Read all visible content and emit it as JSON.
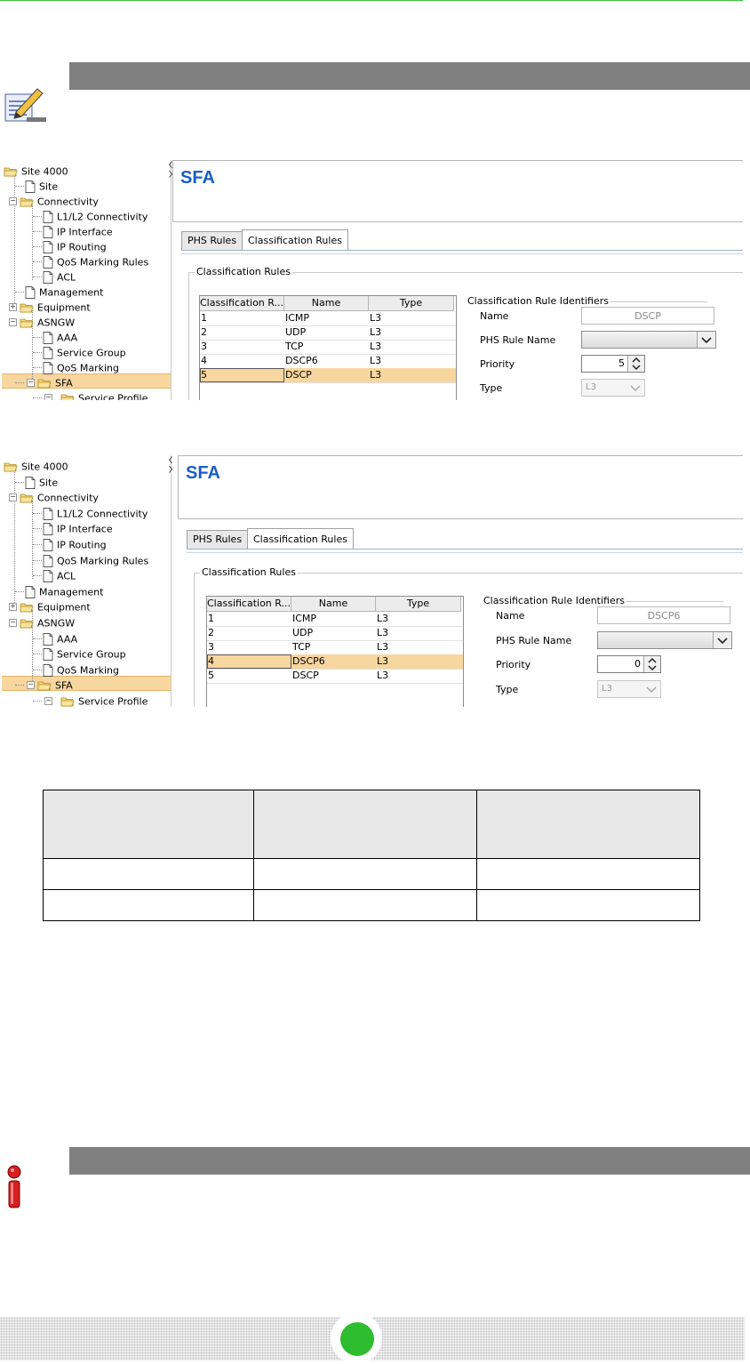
{
  "screenshots": [
    {
      "tree": {
        "root": "Site 4000",
        "items": [
          "Site",
          "Connectivity",
          "L1/L2 Connectivity",
          "IP Interface",
          "IP Routing",
          "QoS Marking Rules",
          "ACL",
          "Management",
          "Equipment",
          "ASNGW",
          "AAA",
          "Service Group",
          "QoS Marking",
          "SFA",
          "Service Profile"
        ]
      },
      "panel_title": "SFA",
      "tabs": [
        "PHS Rules",
        "Classification Rules"
      ],
      "group_title": "Classification Rules",
      "table": {
        "columns": [
          "Classification R...",
          "Name",
          "Type"
        ],
        "rows": [
          [
            "1",
            "ICMP",
            "L3"
          ],
          [
            "2",
            "UDP",
            "L3"
          ],
          [
            "3",
            "TCP",
            "L3"
          ],
          [
            "4",
            "DSCP6",
            "L3"
          ],
          [
            "5",
            "DSCP",
            "L3"
          ]
        ],
        "selected_row": 5
      },
      "identifiers": {
        "title": "Classification Rule Identifiers",
        "name_label": "Name",
        "name_value": "DSCP",
        "phs_label": "PHS Rule Name",
        "priority_label": "Priority",
        "priority_value": "5",
        "type_label": "Type",
        "type_value": "L3"
      }
    },
    {
      "tree": {
        "root": "Site 4000",
        "items": [
          "Site",
          "Connectivity",
          "L1/L2 Connectivity",
          "IP Interface",
          "IP Routing",
          "QoS Marking Rules",
          "ACL",
          "Management",
          "Equipment",
          "ASNGW",
          "AAA",
          "Service Group",
          "QoS Marking",
          "SFA",
          "Service Profile"
        ]
      },
      "panel_title": "SFA",
      "tabs": [
        "PHS Rules",
        "Classification Rules"
      ],
      "group_title": "Classification Rules",
      "table": {
        "columns": [
          "Classification R...",
          "Name",
          "Type"
        ],
        "rows": [
          [
            "1",
            "ICMP",
            "L3"
          ],
          [
            "2",
            "UDP",
            "L3"
          ],
          [
            "3",
            "TCP",
            "L3"
          ],
          [
            "4",
            "DSCP6",
            "L3"
          ],
          [
            "5",
            "DSCP",
            "L3"
          ]
        ],
        "selected_row": 4
      },
      "identifiers": {
        "title": "Classification Rule Identifiers",
        "name_label": "Name",
        "name_value": "DSCP6",
        "phs_label": "PHS Rule Name",
        "priority_label": "Priority",
        "priority_value": "0",
        "type_label": "Type",
        "type_value": "L3"
      }
    }
  ],
  "icons": {
    "note": "note-pencil-icon",
    "important": "important-info-icon",
    "folder": "folder-icon",
    "page": "page-icon",
    "spin": "spinner-arrows-icon",
    "dropdown": "chevron-down-icon"
  },
  "colors": {
    "accent_green": "#2ebd2e",
    "title_blue": "#1a5dc8",
    "selection": "#f7d69f",
    "bar_grey": "#808080"
  }
}
